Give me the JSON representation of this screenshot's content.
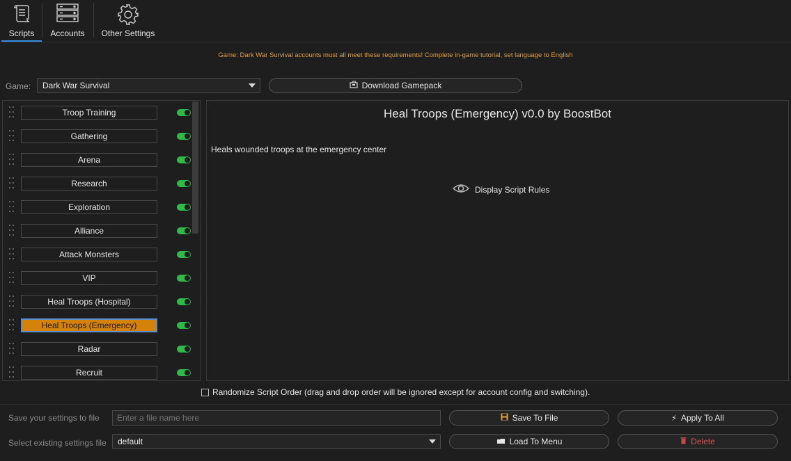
{
  "tabs": [
    {
      "label": "Scripts",
      "icon": "scroll-icon",
      "active": true
    },
    {
      "label": "Accounts",
      "icon": "server-rack-icon",
      "active": false
    },
    {
      "label": "Other Settings",
      "icon": "gear-icon",
      "active": false
    }
  ],
  "notice": "Game: Dark War Survival accounts must all meet these requirements! Complete in-game tutorial, set language to English",
  "game": {
    "label": "Game:",
    "selected": "Dark War Survival",
    "download_label": "Download Gamepack"
  },
  "scripts": [
    {
      "label": "Troop Training",
      "enabled": true,
      "selected": false
    },
    {
      "label": "Gathering",
      "enabled": true,
      "selected": false
    },
    {
      "label": "Arena",
      "enabled": true,
      "selected": false
    },
    {
      "label": "Research",
      "enabled": true,
      "selected": false
    },
    {
      "label": "Exploration",
      "enabled": true,
      "selected": false
    },
    {
      "label": "Alliance",
      "enabled": true,
      "selected": false
    },
    {
      "label": "Attack Monsters",
      "enabled": true,
      "selected": false
    },
    {
      "label": "VIP",
      "enabled": true,
      "selected": false
    },
    {
      "label": "Heal Troops (Hospital)",
      "enabled": true,
      "selected": false
    },
    {
      "label": "Heal Troops (Emergency)",
      "enabled": true,
      "selected": true
    },
    {
      "label": "Radar",
      "enabled": true,
      "selected": false
    },
    {
      "label": "Recruit",
      "enabled": true,
      "selected": false
    }
  ],
  "detail": {
    "title": "Heal Troops (Emergency) v0.0 by BoostBot",
    "description": "Heals wounded troops at the emergency center",
    "rules_label": "Display Script Rules"
  },
  "randomize_label": "Randomize Script Order (drag and drop order will be ignored except for account config and switching).",
  "settings": {
    "save_label": "Save your settings to file",
    "file_placeholder": "Enter a file name here",
    "select_label": "Select existing settings file",
    "selected_file": "default",
    "save_button": "Save To File",
    "apply_button": "Apply To All",
    "load_button": "Load To Menu",
    "delete_button": "Delete"
  },
  "colors": {
    "accent_tab": "#3a8ee6",
    "notice": "#e0a03a",
    "selected_script": "#d4820a",
    "toggle_on": "#31b84a",
    "delete": "#e05050"
  }
}
